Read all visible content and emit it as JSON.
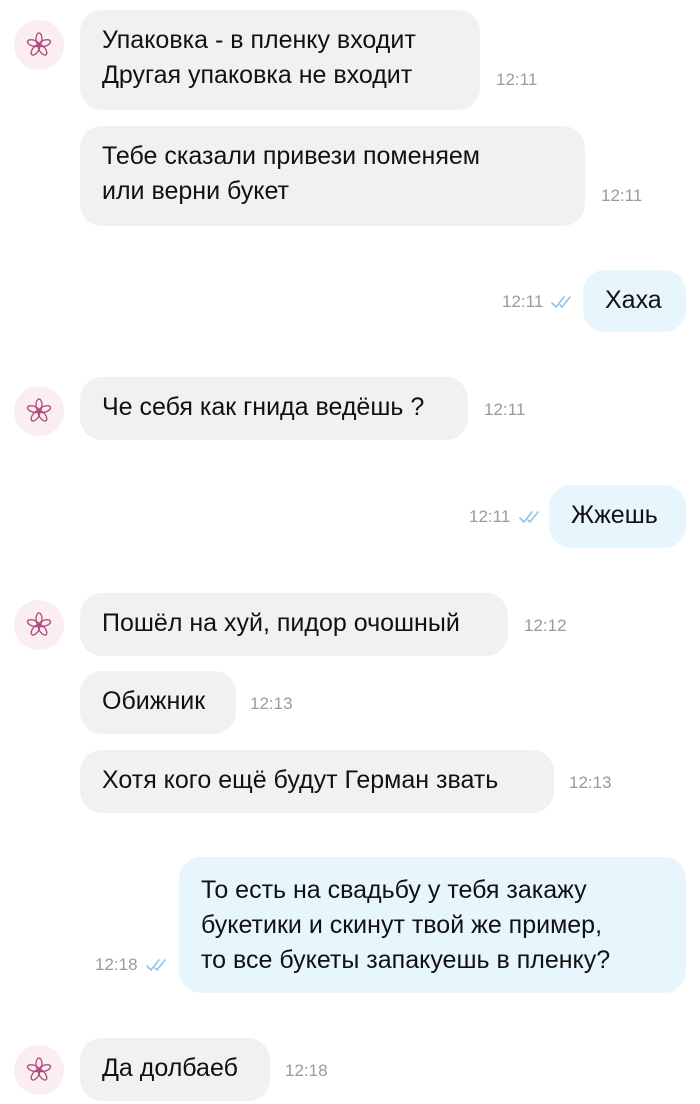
{
  "messages": [
    {
      "dir": "in",
      "lines": [
        "Упаковка - в пленку входит",
        "Другая упаковка не входит"
      ],
      "time": "12:11"
    },
    {
      "dir": "in",
      "lines": [
        "Тебе сказали привези поменяем",
        "или верни букет"
      ],
      "time": "12:11"
    },
    {
      "dir": "out",
      "lines": [
        "Хаха"
      ],
      "time": "12:11",
      "read": true
    },
    {
      "dir": "in",
      "lines": [
        "Че себя как гнида ведёшь ?"
      ],
      "time": "12:11"
    },
    {
      "dir": "out",
      "lines": [
        "Жжешь"
      ],
      "time": "12:11",
      "read": true
    },
    {
      "dir": "in",
      "lines": [
        "Пошёл на хуй, пидор очошный"
      ],
      "time": "12:12"
    },
    {
      "dir": "in",
      "lines": [
        "Обижник"
      ],
      "time": "12:13"
    },
    {
      "dir": "in",
      "lines": [
        "Хотя кого ещё будут Герман звать"
      ],
      "time": "12:13"
    },
    {
      "dir": "out",
      "lines": [
        "То есть на свадьбу у тебя закажу",
        "букетики и скинут твой же пример,",
        "то все букеты запакуешь в пленку?"
      ],
      "time": "12:18",
      "read": true
    },
    {
      "dir": "in",
      "lines": [
        "Да долбаеб"
      ],
      "time": "12:18"
    }
  ],
  "colors": {
    "incoming_bubble": "#f1f1f2",
    "outgoing_bubble": "#e7f5fd",
    "read_checks": "#8fc4e6",
    "avatar_bg": "#fbeef0",
    "avatar_flower": "#b0477a"
  },
  "icons": {
    "avatar": "flower-logo-icon",
    "read_status": "double-check-icon"
  }
}
